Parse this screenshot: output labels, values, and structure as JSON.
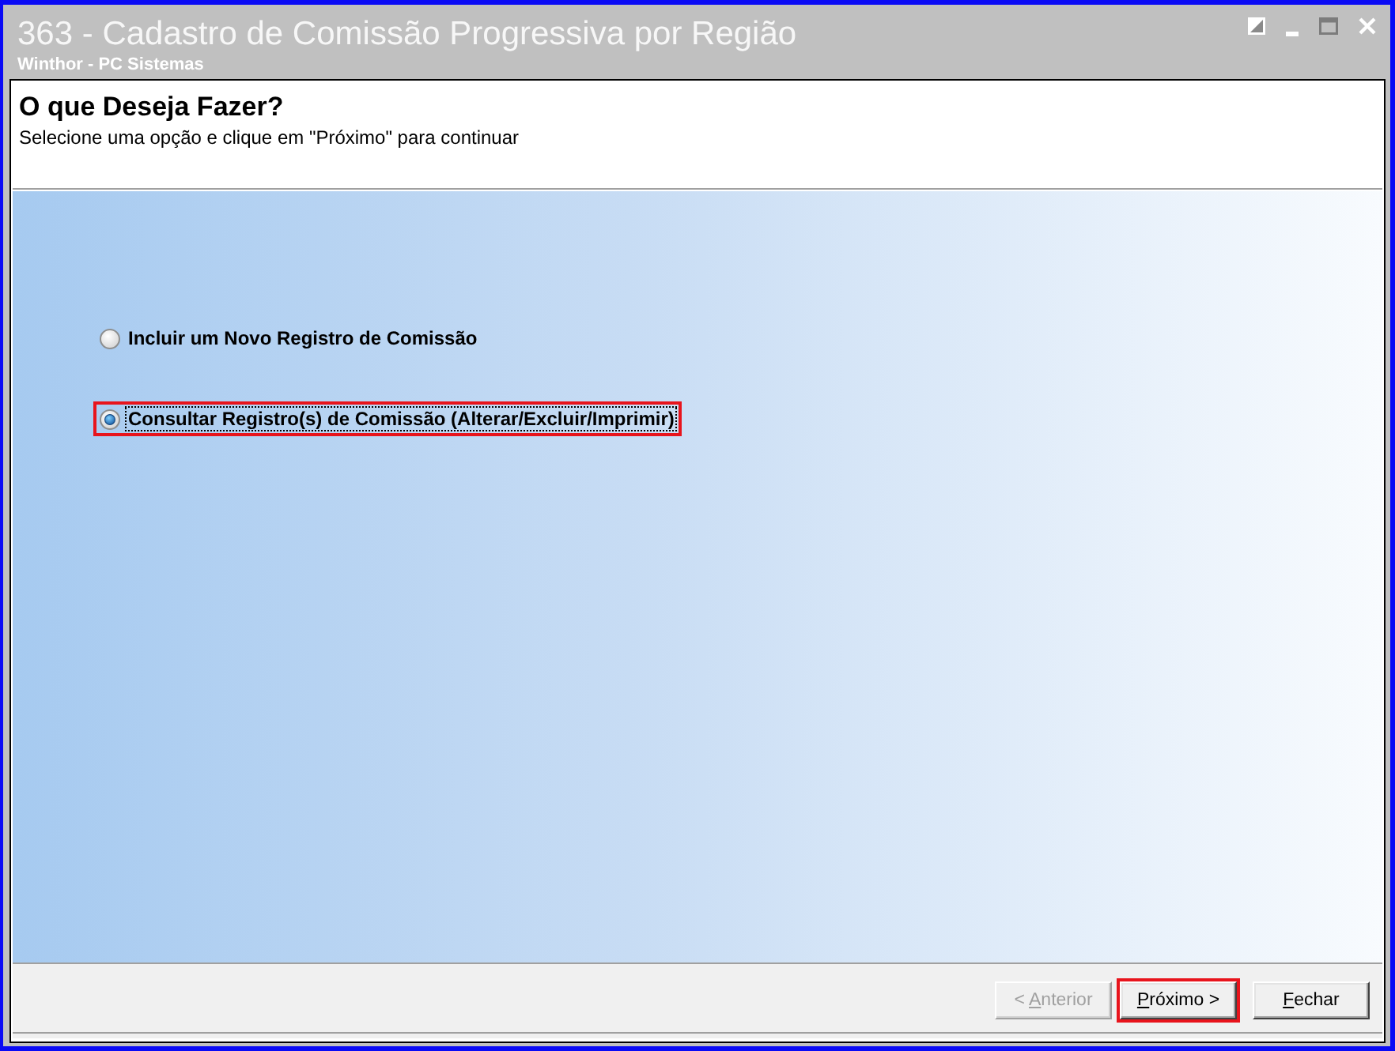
{
  "window": {
    "title": "363 - Cadastro de Comissão Progressiva por Região",
    "subtitle": "Winthor - PC Sistemas"
  },
  "header": {
    "title": "O que Deseja Fazer?",
    "instruction": "Selecione uma opção e clique em \"Próximo\" para continuar"
  },
  "options": [
    {
      "label": "Incluir um Novo Registro de Comissão",
      "selected": false,
      "focused": false,
      "highlighted": false
    },
    {
      "label": "Consultar Registro(s) de Comissão (Alterar/Excluir/Imprimir)",
      "selected": true,
      "focused": true,
      "highlighted": true
    }
  ],
  "buttons": [
    {
      "label": "< Anterior",
      "access_key_underlined": true,
      "disabled": true,
      "highlighted": false
    },
    {
      "label": "Próximo >",
      "access_key_underlined": true,
      "disabled": false,
      "highlighted": true
    },
    {
      "label": "Fechar",
      "access_key_underlined": true,
      "disabled": false,
      "highlighted": false
    }
  ]
}
